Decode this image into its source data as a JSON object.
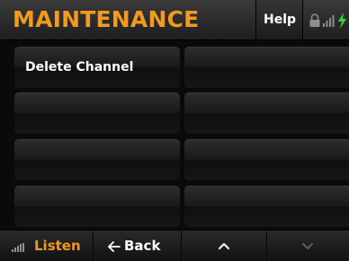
{
  "header": {
    "title": "MAINTENANCE",
    "help_label": "Help"
  },
  "colors": {
    "accent": "#f39a1d",
    "text": "#ffffff",
    "status_green": "#3dd13d"
  },
  "icons": [
    "lock-icon",
    "signal-icon",
    "bolt-icon",
    "listen-signal-icon",
    "back-arrow-icon",
    "chevron-up-icon",
    "chevron-down-icon"
  ],
  "grid": {
    "buttons": [
      {
        "label": "Delete Channel"
      },
      {
        "label": ""
      },
      {
        "label": ""
      },
      {
        "label": ""
      },
      {
        "label": ""
      },
      {
        "label": ""
      },
      {
        "label": ""
      },
      {
        "label": ""
      }
    ]
  },
  "bottom_bar": {
    "listen_label": "Listen",
    "back_label": "Back"
  }
}
